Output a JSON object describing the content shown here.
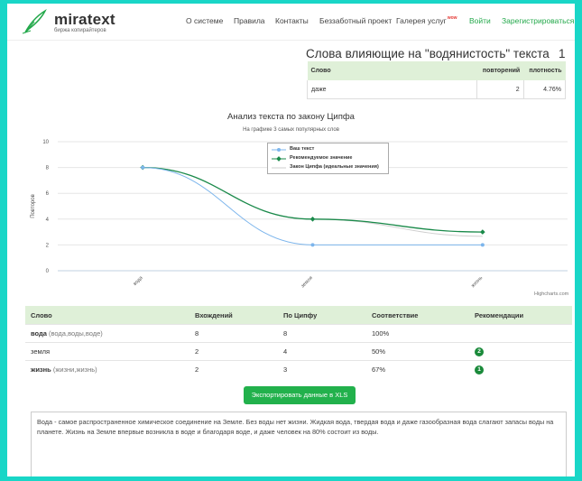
{
  "header": {
    "logo_name": "miratext",
    "logo_sub": "биржа копирайтеров",
    "nav": [
      "О системе",
      "Правила",
      "Контакты",
      "Беззаботный проект",
      "Галерея услуг"
    ],
    "wow": "wow",
    "login": "Войти",
    "register": "Зарегистрироваться",
    "accent_color": "#22a84a"
  },
  "words_block": {
    "title": "Слова влияющие на \"водянистость\" текста",
    "count": "1",
    "columns": [
      "Слово",
      "повторений",
      "плотность"
    ],
    "rows": [
      {
        "word": "даже",
        "repeats": "2",
        "density": "4.76%"
      }
    ]
  },
  "chart": {
    "credits": "Highcharts.com"
  },
  "chart_data": {
    "type": "line",
    "title": "Анализ текста по закону Ципфа",
    "subtitle": "На графике 3 самых популярных слов",
    "categories": [
      "вода",
      "земля",
      "жизнь"
    ],
    "ylabel": "Повторов",
    "ylim": [
      0,
      10
    ],
    "yticks": [
      "0",
      "2",
      "4",
      "6",
      "8",
      "10"
    ],
    "grid": true,
    "legend_position": "top-center",
    "series": [
      {
        "name": "Ваш текст",
        "values": [
          8,
          2,
          2
        ],
        "color": "#7cb5ec"
      },
      {
        "name": "Рекомендуемое значение",
        "values": [
          8,
          4,
          3
        ],
        "color": "#1a8a4a"
      },
      {
        "name": "Закон Ципфа (идеальные значения)",
        "values": [
          8,
          4,
          2.67
        ],
        "color": "#cfcfcf"
      }
    ]
  },
  "main_table": {
    "columns": [
      "Слово",
      "Вхождений",
      "По Ципфу",
      "Соответствие",
      "Рекомендации"
    ],
    "rows": [
      {
        "word": "вода",
        "synonyms": "(вода,воды,воде)",
        "count": "8",
        "zipf": "8",
        "match": "100%",
        "rec": ""
      },
      {
        "word": "земля",
        "synonyms": "",
        "count": "2",
        "zipf": "4",
        "match": "50%",
        "rec": "2"
      },
      {
        "word": "жизнь",
        "synonyms": "(жизни,жизнь)",
        "count": "2",
        "zipf": "3",
        "match": "67%",
        "rec": "1"
      }
    ]
  },
  "export_label": "Экспортировать данные в XLS",
  "text_content": "Вода - самое распространенное химическое соединение на Земле. Без воды нет жизни. Жидкая вода, твердая вода и даже газообразная вода слагают запасы воды на планете. Жизнь на Земле впервые возникла в воде и благодаря воде, и даже человек на 80% состоит из воды."
}
